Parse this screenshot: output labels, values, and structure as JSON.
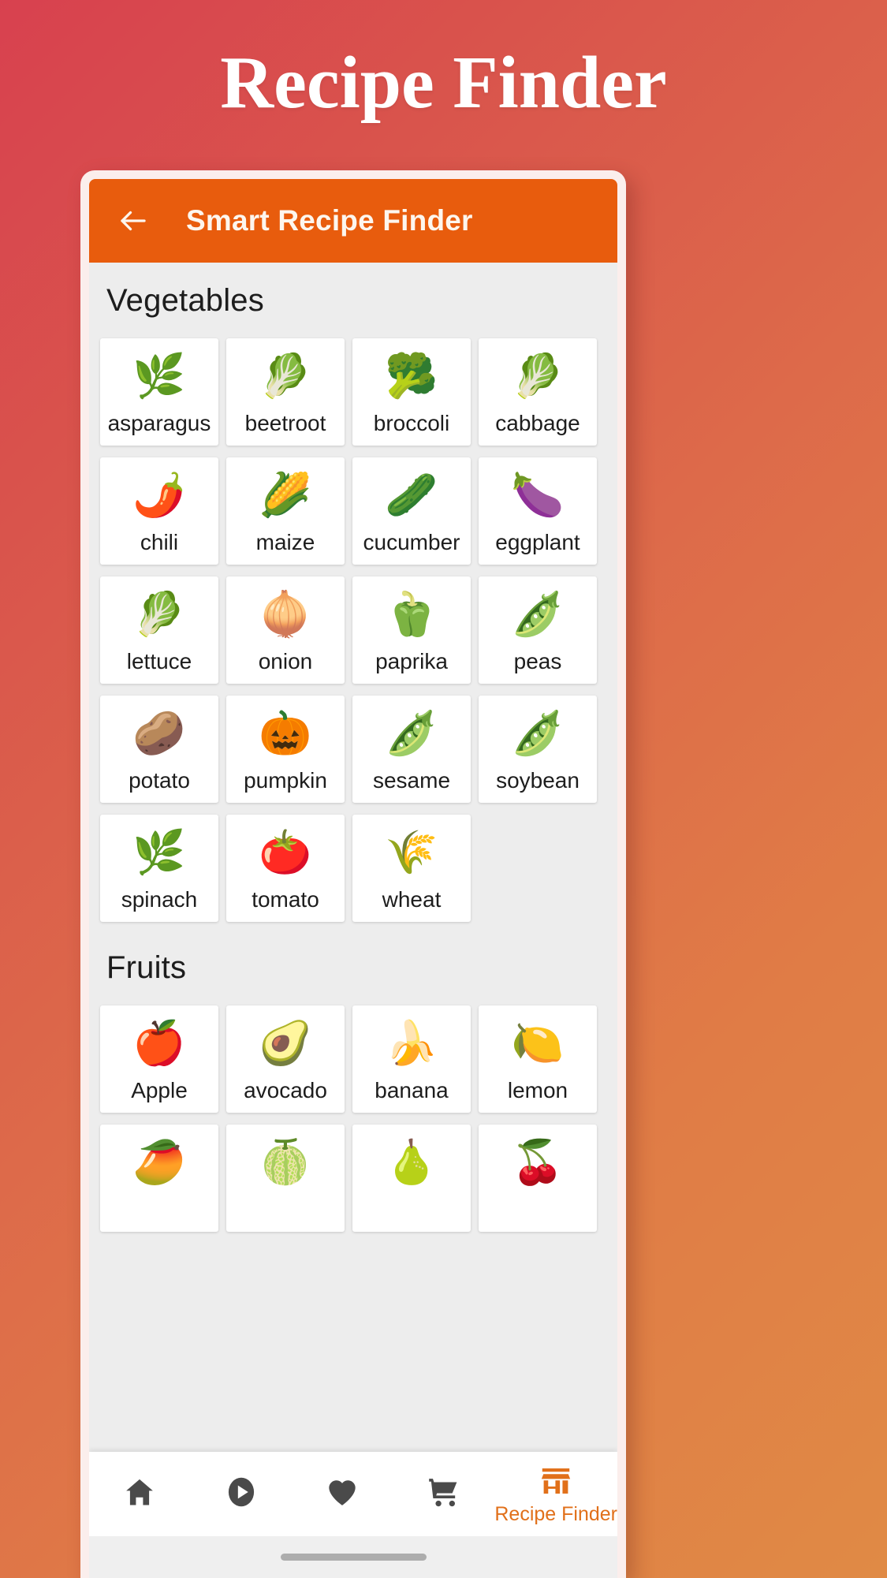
{
  "page": {
    "title": "Recipe Finder",
    "background_gradient_from": "#d8414f",
    "background_gradient_to": "#e08a45"
  },
  "appbar": {
    "back_icon": "arrow-left-icon",
    "title": "Smart Recipe Finder",
    "background": "#e85c0d",
    "text_color": "#fdf6ee"
  },
  "sections": [
    {
      "title": "Vegetables",
      "items": [
        {
          "label": "asparagus",
          "emoji": "🌿",
          "icon": "asparagus-icon"
        },
        {
          "label": "beetroot",
          "emoji": "🥬",
          "icon": "beetroot-icon"
        },
        {
          "label": "broccoli",
          "emoji": "🥦",
          "icon": "broccoli-icon"
        },
        {
          "label": "cabbage",
          "emoji": "🥬",
          "icon": "cabbage-icon"
        },
        {
          "label": "chili",
          "emoji": "🌶️",
          "icon": "chili-icon"
        },
        {
          "label": "maize",
          "emoji": "🌽",
          "icon": "maize-icon"
        },
        {
          "label": "cucumber",
          "emoji": "🥒",
          "icon": "cucumber-icon"
        },
        {
          "label": "eggplant",
          "emoji": "🍆",
          "icon": "eggplant-icon"
        },
        {
          "label": "lettuce",
          "emoji": "🥬",
          "icon": "lettuce-icon"
        },
        {
          "label": "onion",
          "emoji": "🧅",
          "icon": "onion-icon"
        },
        {
          "label": "paprika",
          "emoji": "🫑",
          "icon": "paprika-icon"
        },
        {
          "label": "peas",
          "emoji": "🫛",
          "icon": "peas-icon"
        },
        {
          "label": "potato",
          "emoji": "🥔",
          "icon": "potato-icon"
        },
        {
          "label": "pumpkin",
          "emoji": "🎃",
          "icon": "pumpkin-icon"
        },
        {
          "label": "sesame",
          "emoji": "🫛",
          "icon": "sesame-icon"
        },
        {
          "label": "soybean",
          "emoji": "🫛",
          "icon": "soybean-icon"
        },
        {
          "label": "spinach",
          "emoji": "🌿",
          "icon": "spinach-icon"
        },
        {
          "label": "tomato",
          "emoji": "🍅",
          "icon": "tomato-icon"
        },
        {
          "label": "wheat",
          "emoji": "🌾",
          "icon": "wheat-icon"
        }
      ]
    },
    {
      "title": "Fruits",
      "items": [
        {
          "label": "Apple",
          "emoji": "🍎",
          "icon": "apple-icon"
        },
        {
          "label": "avocado",
          "emoji": "🥑",
          "icon": "avocado-icon"
        },
        {
          "label": "banana",
          "emoji": "🍌",
          "icon": "banana-icon"
        },
        {
          "label": "lemon",
          "emoji": "🍋",
          "icon": "lemon-icon"
        }
      ]
    }
  ],
  "partial_row": [
    {
      "emoji": "🥭",
      "icon": "mango-icon"
    },
    {
      "emoji": "🍈",
      "icon": "melon-icon"
    },
    {
      "emoji": "🍐",
      "icon": "pear-icon"
    },
    {
      "emoji": "🍒",
      "icon": "cherry-icon"
    }
  ],
  "bottom_nav": {
    "active_color": "#e1701a",
    "inactive_color": "#4a4a4a",
    "items": [
      {
        "icon": "home-icon",
        "label": ""
      },
      {
        "icon": "play-circle-icon",
        "label": ""
      },
      {
        "icon": "heart-icon",
        "label": ""
      },
      {
        "icon": "shopping-cart-icon",
        "label": ""
      },
      {
        "icon": "store-icon",
        "label": "Recipe Finder"
      }
    ]
  },
  "home_indicator": {
    "name": "home-indicator"
  }
}
